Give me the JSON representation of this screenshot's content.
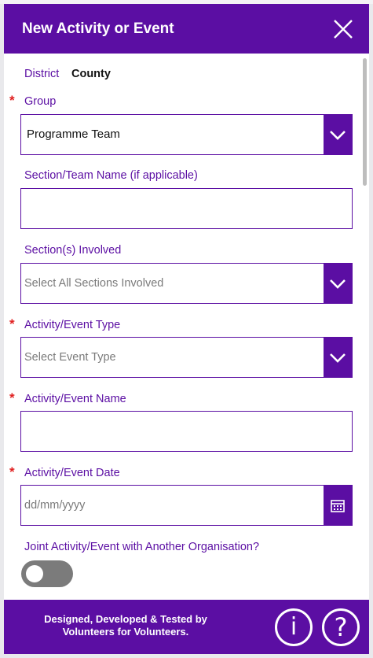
{
  "header": {
    "title": "New Activity or Event"
  },
  "form": {
    "district_label": "District",
    "district_value": "County",
    "group": {
      "label": "Group",
      "required_marker": "*",
      "value": "Programme Team"
    },
    "section_team_name": {
      "label": "Section/Team Name (if applicable)",
      "value": ""
    },
    "sections_involved": {
      "label": "Section(s) Involved",
      "placeholder": "Select All Sections Involved"
    },
    "event_type": {
      "label": "Activity/Event Type",
      "required_marker": "*",
      "placeholder": "Select Event Type"
    },
    "event_name": {
      "label": "Activity/Event Name",
      "required_marker": "*",
      "value": ""
    },
    "event_date": {
      "label": "Activity/Event Date",
      "required_marker": "*",
      "placeholder": "dd/mm/yyyy"
    },
    "joint_event": {
      "label": "Joint Activity/Event with Another Organisation?",
      "toggle_on": false
    }
  },
  "footer": {
    "line1": "Designed, Developed & Tested by",
    "line2": "Volunteers for Volunteers.",
    "info_glyph": "i",
    "help_glyph": "?"
  },
  "colors": {
    "accent": "#5b0ea3",
    "required": "#e02020",
    "toggle_off": "#7b7b7b"
  },
  "icons": {
    "close": "close-icon",
    "dropdown": "chevron-down-icon",
    "calendar": "calendar-icon",
    "info": "info-icon",
    "help": "help-icon"
  }
}
